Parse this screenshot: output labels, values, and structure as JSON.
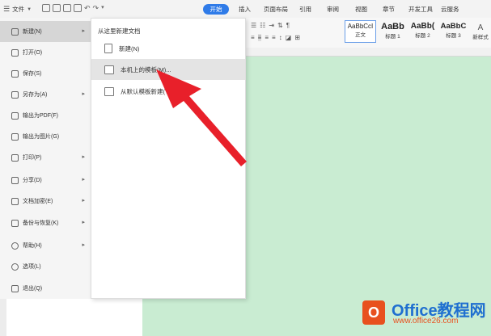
{
  "titlebar": {
    "file_label": "文件",
    "tabs": [
      "开始",
      "插入",
      "页面布局",
      "引用",
      "审阅",
      "视图",
      "章节",
      "开发工具",
      "云服务"
    ]
  },
  "ribbon": {
    "styles": [
      {
        "sample": "AaBbCcI",
        "name": "正文"
      },
      {
        "sample": "AaBb",
        "name": "标题 1"
      },
      {
        "sample": "AaBb(",
        "name": "标题 2"
      },
      {
        "sample": "AaBbC",
        "name": "标题 3"
      }
    ],
    "new_style_label": "新样式"
  },
  "file_menu": {
    "items": [
      {
        "label": "新建(N)",
        "icon": "new-doc-icon",
        "arrow": true
      },
      {
        "label": "打开(O)",
        "icon": "folder-icon",
        "arrow": false
      },
      {
        "label": "保存(S)",
        "icon": "save-icon",
        "arrow": false
      },
      {
        "label": "另存为(A)",
        "icon": "save-as-icon",
        "arrow": true
      },
      {
        "label": "输出为PDF(F)",
        "icon": "pdf-icon",
        "arrow": false
      },
      {
        "label": "输出为图片(G)",
        "icon": "image-icon",
        "arrow": false
      },
      {
        "label": "打印(P)",
        "icon": "printer-icon",
        "arrow": true
      },
      {
        "label": "分享(D)",
        "icon": "share-icon",
        "arrow": true
      },
      {
        "label": "文档加密(E)",
        "icon": "lock-icon",
        "arrow": true
      },
      {
        "label": "备份与恢复(K)",
        "icon": "backup-icon",
        "arrow": true
      },
      {
        "label": "帮助(H)",
        "icon": "help-icon",
        "arrow": true
      },
      {
        "label": "选项(L)",
        "icon": "gear-icon",
        "arrow": false
      },
      {
        "label": "退出(Q)",
        "icon": "exit-icon",
        "arrow": false
      }
    ]
  },
  "new_submenu": {
    "title": "从这里新建文档",
    "items": [
      {
        "label": "新建(N)"
      },
      {
        "label": "本机上的模板(M)..."
      },
      {
        "label": "从默认模板新建(T)"
      }
    ]
  },
  "watermark": {
    "logo_letter": "O",
    "title": "Office教程网",
    "url": "www.office26.com"
  },
  "colors": {
    "accent": "#2f7be8",
    "document_bg": "#c9ecd2",
    "arrow": "#e8202a",
    "watermark_orange": "#e8501e",
    "watermark_blue": "#1f6fd0"
  }
}
